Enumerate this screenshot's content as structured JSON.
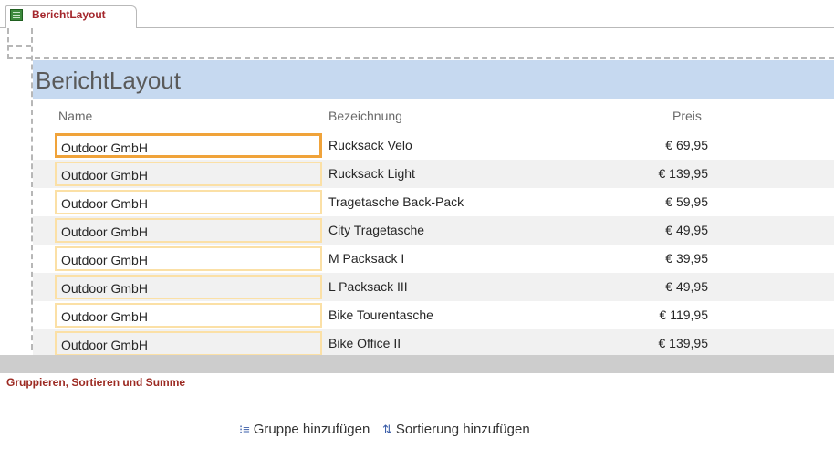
{
  "tab": {
    "label": "BerichtLayout"
  },
  "report": {
    "title": "BerichtLayout",
    "columns": {
      "name": "Name",
      "bezeichnung": "Bezeichnung",
      "preis": "Preis"
    },
    "rows": [
      {
        "name": "Outdoor GmbH",
        "bezeichnung": "Rucksack Velo",
        "preis": "€ 69,95"
      },
      {
        "name": "Outdoor GmbH",
        "bezeichnung": "Rucksack Light",
        "preis": "€ 139,95"
      },
      {
        "name": "Outdoor GmbH",
        "bezeichnung": "Tragetasche Back-Pack",
        "preis": "€ 59,95"
      },
      {
        "name": "Outdoor GmbH",
        "bezeichnung": "City Tragetasche",
        "preis": "€ 49,95"
      },
      {
        "name": "Outdoor GmbH",
        "bezeichnung": "M Packsack I",
        "preis": "€ 39,95"
      },
      {
        "name": "Outdoor GmbH",
        "bezeichnung": "L Packsack III",
        "preis": "€ 49,95"
      },
      {
        "name": "Outdoor GmbH",
        "bezeichnung": "Bike Tourentasche",
        "preis": "€ 119,95"
      },
      {
        "name": "Outdoor GmbH",
        "bezeichnung": "Bike Office II",
        "preis": "€ 139,95"
      }
    ]
  },
  "group_pane": {
    "label": "Gruppieren, Sortieren und Summe",
    "add_group": "Gruppe hinzufügen",
    "add_sort": "Sortierung hinzufügen",
    "add_group_icon": "group-list-icon",
    "add_sort_icon": "sort-az-icon"
  },
  "colors": {
    "accent_red": "#a4262c",
    "title_band": "#c6d9f0",
    "selected_border": "#f0a33a",
    "column_border": "#fbe0a6"
  }
}
